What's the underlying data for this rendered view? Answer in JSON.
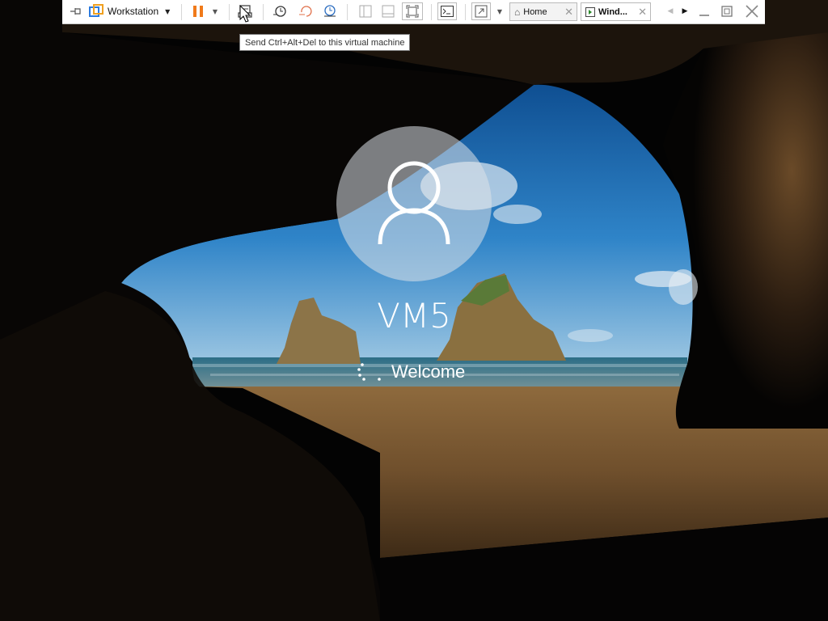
{
  "toolbar": {
    "app_menu_label": "Workstation",
    "icons": {
      "pin": "pin-icon",
      "app": "workstation-icon",
      "pause": "pause-icon",
      "send_cad": "send-ctrl-alt-del-icon",
      "snapshot": "snapshot-icon",
      "revert": "revert-snapshot-icon",
      "manage_snapshots": "snapshot-manager-icon",
      "console": "console-view-icon",
      "fullscreen": "fullscreen-icon"
    }
  },
  "tabs": [
    {
      "label": "Home",
      "icon": "home-icon"
    },
    {
      "label": "Wind...",
      "icon": "vm-icon"
    }
  ],
  "tooltip": {
    "text": "Send Ctrl+Alt+Del to this virtual machine"
  },
  "login": {
    "username": "VM5",
    "status": "Welcome"
  },
  "colors": {
    "pause_accent": "#f07a1a",
    "toolbar_bg": "#ffffff",
    "sky": "#1f67b0",
    "sand": "#7a5630"
  }
}
